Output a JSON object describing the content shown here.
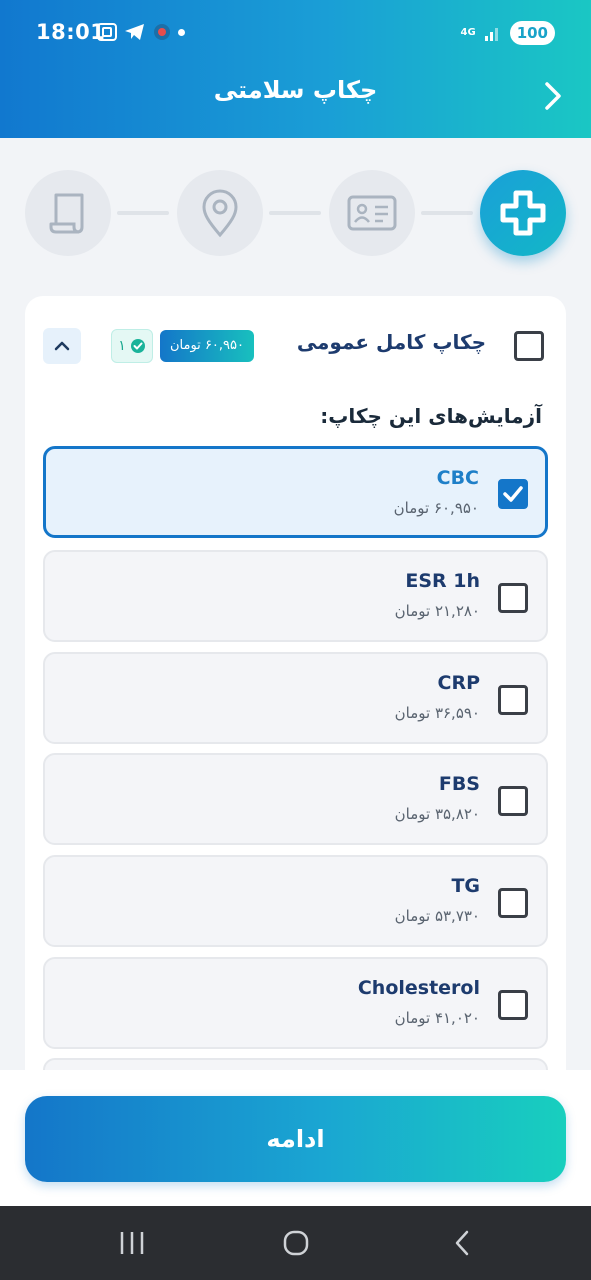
{
  "status_bar": {
    "time": "18:01",
    "network": "4G",
    "battery": "100"
  },
  "header": {
    "title": "چکاپ سلامتی"
  },
  "stepper": {
    "steps": [
      "health-cross-icon",
      "id-card-icon",
      "location-pin-icon",
      "document-scroll-icon"
    ],
    "active_index": 0
  },
  "package": {
    "title": "چکاپ کامل عمومی",
    "price": "۶۰,۹۵۰ تومان",
    "selected_count": "۱",
    "checked": false
  },
  "section_label": "آزمایش‌های این چکاپ:",
  "tests": [
    {
      "name": "CBC",
      "price": "۶۰,۹۵۰ تومان",
      "checked": true
    },
    {
      "name": "ESR 1h",
      "price": "۲۱,۲۸۰ تومان",
      "checked": false
    },
    {
      "name": "CRP",
      "price": "۳۶,۵۹۰ تومان",
      "checked": false
    },
    {
      "name": "FBS",
      "price": "۳۵,۸۲۰ تومان",
      "checked": false
    },
    {
      "name": "TG",
      "price": "۵۳,۷۳۰ تومان",
      "checked": false
    },
    {
      "name": "Cholesterol",
      "price": "۴۱,۰۲۰ تومان",
      "checked": false
    }
  ],
  "continue_button": "ادامه",
  "colors": {
    "accent": "#1476c9",
    "accent_teal": "#18c0be"
  }
}
